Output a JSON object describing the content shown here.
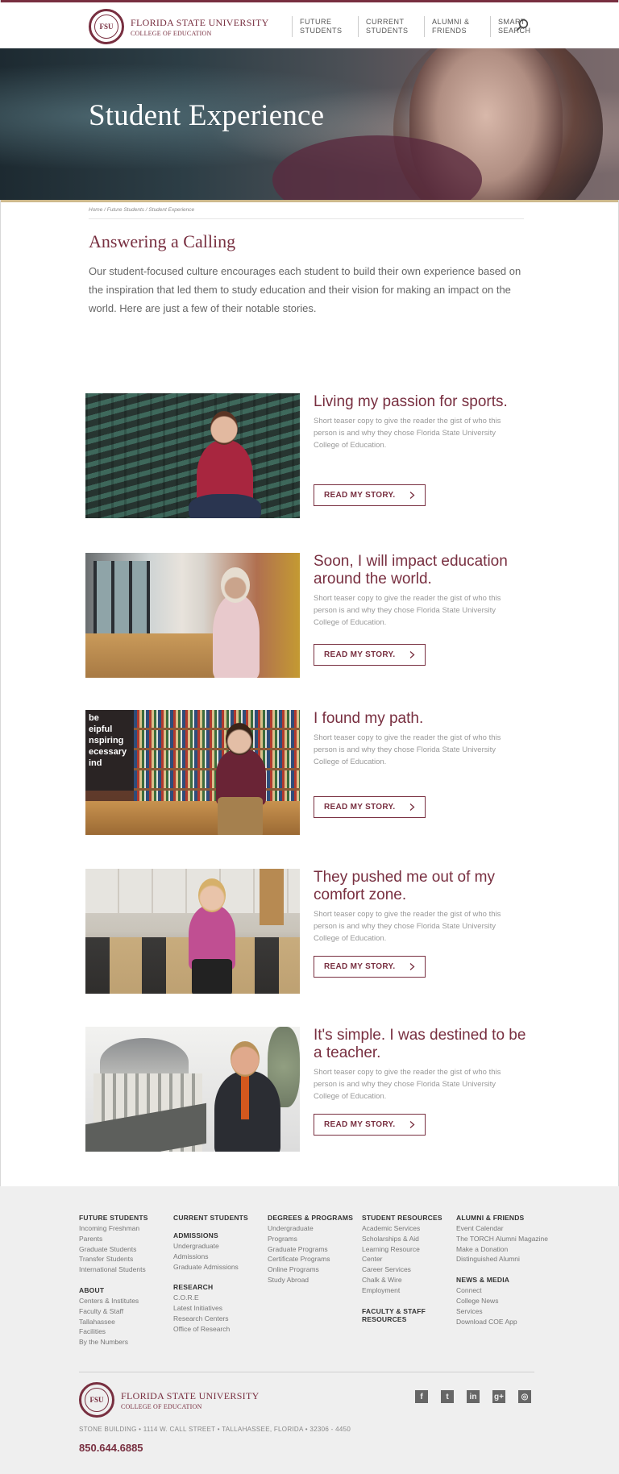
{
  "header": {
    "university": "FLORIDA STATE UNIVERSITY",
    "college": "COLLEGE OF EDUCATION",
    "seal_text": "FSU",
    "nav": [
      {
        "line1": "FUTURE",
        "line2": "STUDENTS"
      },
      {
        "line1": "CURRENT",
        "line2": "STUDENTS"
      },
      {
        "line1": "ALUMNI &",
        "line2": "FRIENDS"
      },
      {
        "line1": "SMART",
        "line2": "SEARCH"
      }
    ],
    "search_icon": "search-icon"
  },
  "hero": {
    "title": "Student Experience"
  },
  "breadcrumb": "Home / Future Students / Student Experience",
  "intro": {
    "title": "Answering a Calling",
    "text": "Our student-focused culture encourages each student to build their own experience based on the inspiration that led them to study education and their vision for making an impact on the world. Here are just a few of their notable stories."
  },
  "stories": [
    {
      "title": "Living my passion for sports.",
      "teaser": "Short teaser copy to give the reader the gist of who this person is and why they chose Florida State University College of Education.",
      "button": "READ MY STORY."
    },
    {
      "title": "Soon, I will impact education around the world.",
      "teaser": "Short teaser copy to give the reader the gist of who this person is and why they chose Florida State University College of Education.",
      "button": "READ MY STORY."
    },
    {
      "title": "I found my path.",
      "teaser": "Short teaser copy to give the reader the gist of who this person is and why they chose Florida State University College of Education.",
      "button": "READ MY STORY."
    },
    {
      "title": "They pushed me out of my comfort zone.",
      "teaser": "Short teaser copy to give the reader the gist of who this person is and why they chose Florida State University College of Education.",
      "button": "READ MY STORY."
    },
    {
      "title": "It's simple. I was destined to be a teacher.",
      "teaser": "Short teaser copy to give the reader the gist of who this person is and why they chose Florida State University College of Education.",
      "button": "READ MY STORY."
    }
  ],
  "photo_text": [
    "be",
    "eipful",
    "nspiring",
    "ecessary",
    "ind"
  ],
  "footer": {
    "columns": [
      {
        "sections": [
          {
            "heading": "FUTURE STUDENTS",
            "links": [
              "Incoming Freshman",
              "Parents",
              "Graduate Students",
              "Transfer Students",
              "International Students"
            ]
          },
          {
            "heading": "ABOUT",
            "links": [
              "Centers & Institutes",
              "Faculty & Staff",
              "Tallahassee",
              "Facilities",
              "By the Numbers"
            ]
          }
        ]
      },
      {
        "sections": [
          {
            "heading": "CURRENT STUDENTS",
            "links": []
          },
          {
            "heading": "ADMISSIONS",
            "links": [
              "Undergraduate",
              "Admissions",
              "Graduate Admissions"
            ]
          },
          {
            "heading": "RESEARCH",
            "links": [
              "C.O.R.E",
              "Latest Initiatives",
              "Research Centers",
              "Office of Research"
            ]
          }
        ]
      },
      {
        "sections": [
          {
            "heading": "DEGREES & PROGRAMS",
            "links": [
              "Undergraduate",
              "Programs",
              "Graduate Programs",
              "Certificate Programs",
              "Online Programs",
              "Study Abroad"
            ]
          }
        ]
      },
      {
        "sections": [
          {
            "heading": "STUDENT RESOURCES",
            "links": [
              "Academic Services",
              "Scholarships & Aid",
              "Learning Resource",
              "Center",
              "Career Services",
              "Chalk & Wire",
              "Employment"
            ]
          },
          {
            "heading": "FACULTY & STAFF RESOURCES",
            "links": []
          }
        ]
      },
      {
        "sections": [
          {
            "heading": "ALUMNI & FRIENDS",
            "links": [
              "Event Calendar",
              "The TORCH Alumni Magazine",
              "Make a Donation",
              "Distinguished Alumni"
            ]
          },
          {
            "heading": "NEWS & MEDIA",
            "links": [
              "Connect",
              "College News",
              "Services",
              "Download COE App"
            ]
          }
        ]
      }
    ],
    "university": "FLORIDA STATE UNIVERSITY",
    "college": "COLLEGE OF EDUCATION",
    "seal_text": "FSU",
    "address": "STONE BUILDING  •  1114 W. CALL STREET  •  TALLAHASSEE, FLORIDA  •  32306 - 4450",
    "phone": "850.644.6885",
    "social": [
      {
        "icon": "facebook-icon",
        "glyph": "f"
      },
      {
        "icon": "twitter-icon",
        "glyph": "t"
      },
      {
        "icon": "linkedin-icon",
        "glyph": "in"
      },
      {
        "icon": "google-plus-icon",
        "glyph": "g+"
      },
      {
        "icon": "instagram-icon",
        "glyph": "◎"
      }
    ]
  },
  "colors": {
    "brand": "#782f40",
    "gold": "#cdb98c",
    "footer_bg": "#efefef"
  }
}
